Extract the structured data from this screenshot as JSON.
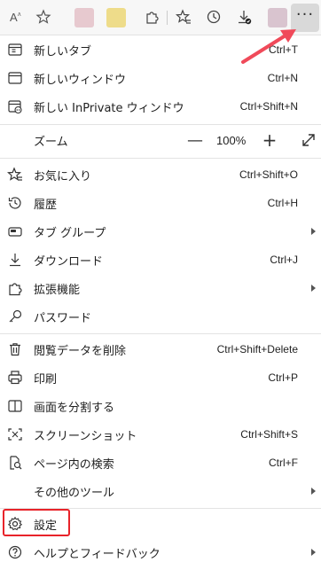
{
  "toolbar": {
    "read_aloud_icon": "read-aloud-icon",
    "favorite_icon": "star-add-icon",
    "more_label": "···"
  },
  "menu": {
    "items": [
      {
        "label": "新しいタブ",
        "shortcut": "Ctrl+T"
      },
      {
        "label": "新しいウィンドウ",
        "shortcut": "Ctrl+N"
      },
      {
        "label": "新しい InPrivate ウィンドウ",
        "shortcut": "Ctrl+Shift+N"
      },
      {
        "label": "ズーム",
        "zoom_minus": "—",
        "zoom_value": "100%",
        "zoom_plus": "+"
      },
      {
        "label": "お気に入り",
        "shortcut": "Ctrl+Shift+O"
      },
      {
        "label": "履歴",
        "shortcut": "Ctrl+H"
      },
      {
        "label": "タブ グループ",
        "submenu": true
      },
      {
        "label": "ダウンロード",
        "shortcut": "Ctrl+J"
      },
      {
        "label": "拡張機能",
        "submenu": true
      },
      {
        "label": "パスワード"
      },
      {
        "label": "閲覧データを削除",
        "shortcut": "Ctrl+Shift+Delete"
      },
      {
        "label": "印刷",
        "shortcut": "Ctrl+P"
      },
      {
        "label": "画面を分割する"
      },
      {
        "label": "スクリーンショット",
        "shortcut": "Ctrl+Shift+S"
      },
      {
        "label": "ページ内の検索",
        "shortcut": "Ctrl+F"
      },
      {
        "label": "その他のツール",
        "submenu": true
      },
      {
        "label": "設定"
      },
      {
        "label": "ヘルプとフィードバック",
        "submenu": true
      }
    ]
  },
  "colors": {
    "annotation_red": "#e8232a",
    "annotation_arrow": "#f04a5a"
  }
}
